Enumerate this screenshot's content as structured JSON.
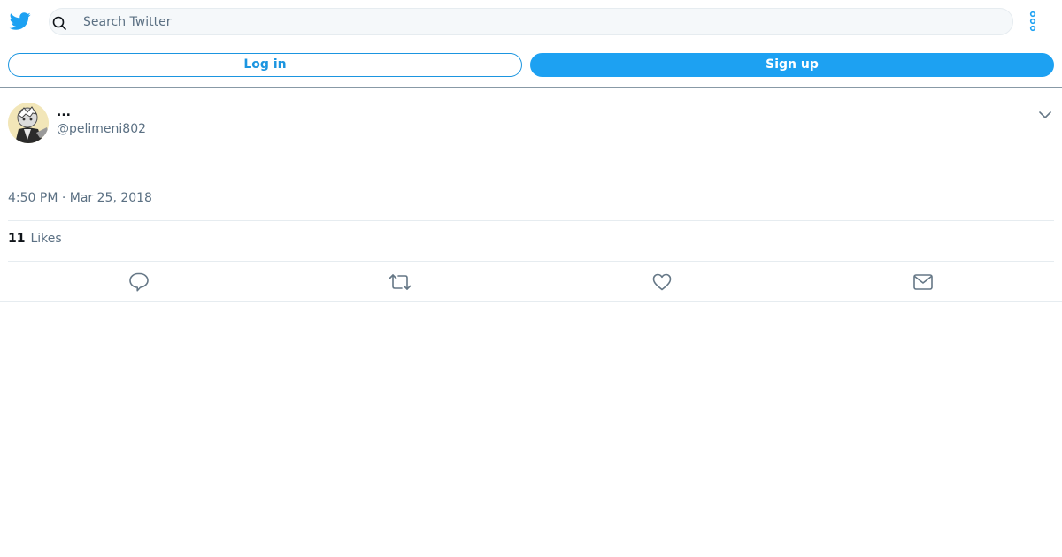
{
  "header": {
    "logo_icon": "twitter-bird-icon",
    "search": {
      "icon": "search-icon",
      "placeholder": "Search Twitter",
      "value": ""
    },
    "more_icon": "more-vertical-icon"
  },
  "auth": {
    "login_label": "Log in",
    "signup_label": "Sign up"
  },
  "tweet": {
    "author": {
      "display_name": "...",
      "handle": "@pelimeni802",
      "avatar_icon": "avatar"
    },
    "timestamp": "4:50 PM · Mar 25, 2018",
    "stats": {
      "likes_count": "11",
      "likes_label": "Likes"
    },
    "actions": [
      {
        "icon": "reply-icon"
      },
      {
        "icon": "retweet-icon"
      },
      {
        "icon": "like-icon"
      },
      {
        "icon": "share-mail-icon"
      }
    ]
  },
  "colors": {
    "brand": "#1da1f2",
    "border": "#e6ecf0",
    "secondary_text": "#5b7083",
    "icon": "#657786"
  }
}
